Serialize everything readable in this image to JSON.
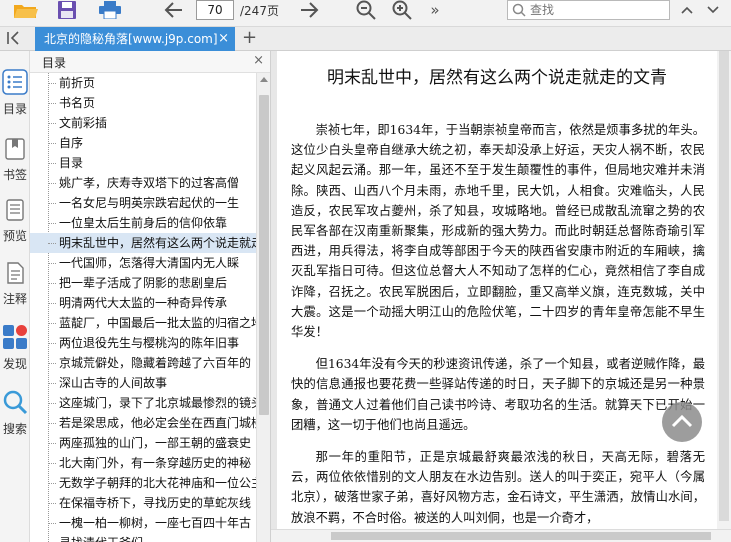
{
  "toolbar": {
    "icons": [
      "open-folder-icon",
      "save-icon",
      "print-icon",
      "back-arrow-icon",
      "zoom-out-icon",
      "zoom-in-icon",
      "more-icon"
    ],
    "page_current": "70",
    "page_total": "/247页",
    "more_label": "»",
    "search_placeholder": "查找",
    "colors": {
      "folder": "#f2a81d",
      "save": "#6a4fb0",
      "print": "#3a7bc8",
      "tab": "#3b8ed8"
    }
  },
  "tabs": {
    "panel_toggle": "K",
    "active_tab": "北京的隐秘角落[www.j9p.com]",
    "close": "×",
    "add": "+"
  },
  "sidebar": {
    "items": [
      {
        "label": "目录",
        "icon": "toc-icon"
      },
      {
        "label": "书签",
        "icon": "bookmark-icon"
      },
      {
        "label": "预览",
        "icon": "preview-icon"
      },
      {
        "label": "注释",
        "icon": "annotation-icon"
      },
      {
        "label": "发现",
        "icon": "discover-icon"
      },
      {
        "label": "搜索",
        "icon": "search-icon"
      }
    ]
  },
  "toc": {
    "title": "目录",
    "close": "×",
    "items": [
      "前折页",
      "书名页",
      "文前彩插",
      "自序",
      "目录",
      "姚广孝，庆寿寺双塔下的过客高僧",
      "一名女尼与明英宗跌宕起伏的一生",
      "一位皇太后生前身后的信仰依靠",
      "明末乱世中，居然有这么两个说走就走的文青",
      "一代国师，怎落得大清国内无人睬",
      "把一辈子活成了阴影的悲剧皇后",
      "明清两代大太监的一种奇异传承",
      "蓝靛厂，中国最后一批太监的归宿之地",
      "两位退役先生与樱桃沟的陈年旧事",
      "京城荒僻处，隐藏着跨越了六百年的",
      "深山古寺的人间故事",
      "这座城门，录下了北京城最惨烈的镜头",
      "若是梁思成，他必定会坐在西直门城楼",
      "两座孤独的山门，一部王朝的盛衰史",
      "北大南门外，有一条穿越历史的神秘",
      "无数学子朝拜的北大花神庙和一位公主",
      "在保福寺桥下，寻找历史的草蛇灰线",
      "一槐一柏一柳树，一座七百四十年古",
      "寻找清代王爷们"
    ],
    "selected_index": 8
  },
  "doc": {
    "title": "明末乱世中，居然有这么两个说走就走的文青",
    "paragraphs": [
      "崇祯七年，即1634年，于当朝崇祯皇帝而言，依然是烦事多扰的年头。这位少白头皇帝自继承大统之初，奉天却没承上好运，天灾人祸不断，农民起义风起云涌。那一年，虽还不至于发生颠覆性的事件，但局地灾难并未消除。陕西、山西八个月未雨，赤地千里，民大饥，人相食。灾难临头，人民造反，农民军攻占夔州，杀了知县，攻城略地。曾经已成散乱流窜之势的农民军各部在汉南重新聚集，形成新的强大势力。而此时朝廷总督陈奇瑜引军西进，用兵得法，将李自成等部困于今天的陕西省安康市附近的车厢峡，擒灭乱军指日可待。但这位总督大人不知动了怎样的仁心，竟然相信了李自成诈降，召抚之。农民军脱困后，立即翻脸，重又高举义旗，连克数城，关中大震。这是一个动摇大明江山的危险伏笔，二十四岁的青年皇帝怎能不早生华发！",
      "但1634年没有今天的秒速资讯传递，杀了一个知县，或者逆贼作降，最快的信息通报也要花费一些驿站传递的时日，天子脚下的京城还是另一种景象，普通文人过着他们自己读书吟诗、考取功名的生活。就算天下已开始一团糟，这一切于他们也尚且遥远。",
      "那一年的重阳节，正是京城最舒爽最浓浅的秋日，天高无际，碧落无云，两位依依惜别的文人朋友在水边告别。送人的叫于奕正，宛平人（今属北京），破落世家子弟，喜好风物方志，金石诗文，平生潇洒，放情山水间，放浪不羁，不合时俗。被送的人叫刘侗，也是一介奇才，"
    ],
    "floating_button_icon": "scroll-to-top-icon"
  }
}
